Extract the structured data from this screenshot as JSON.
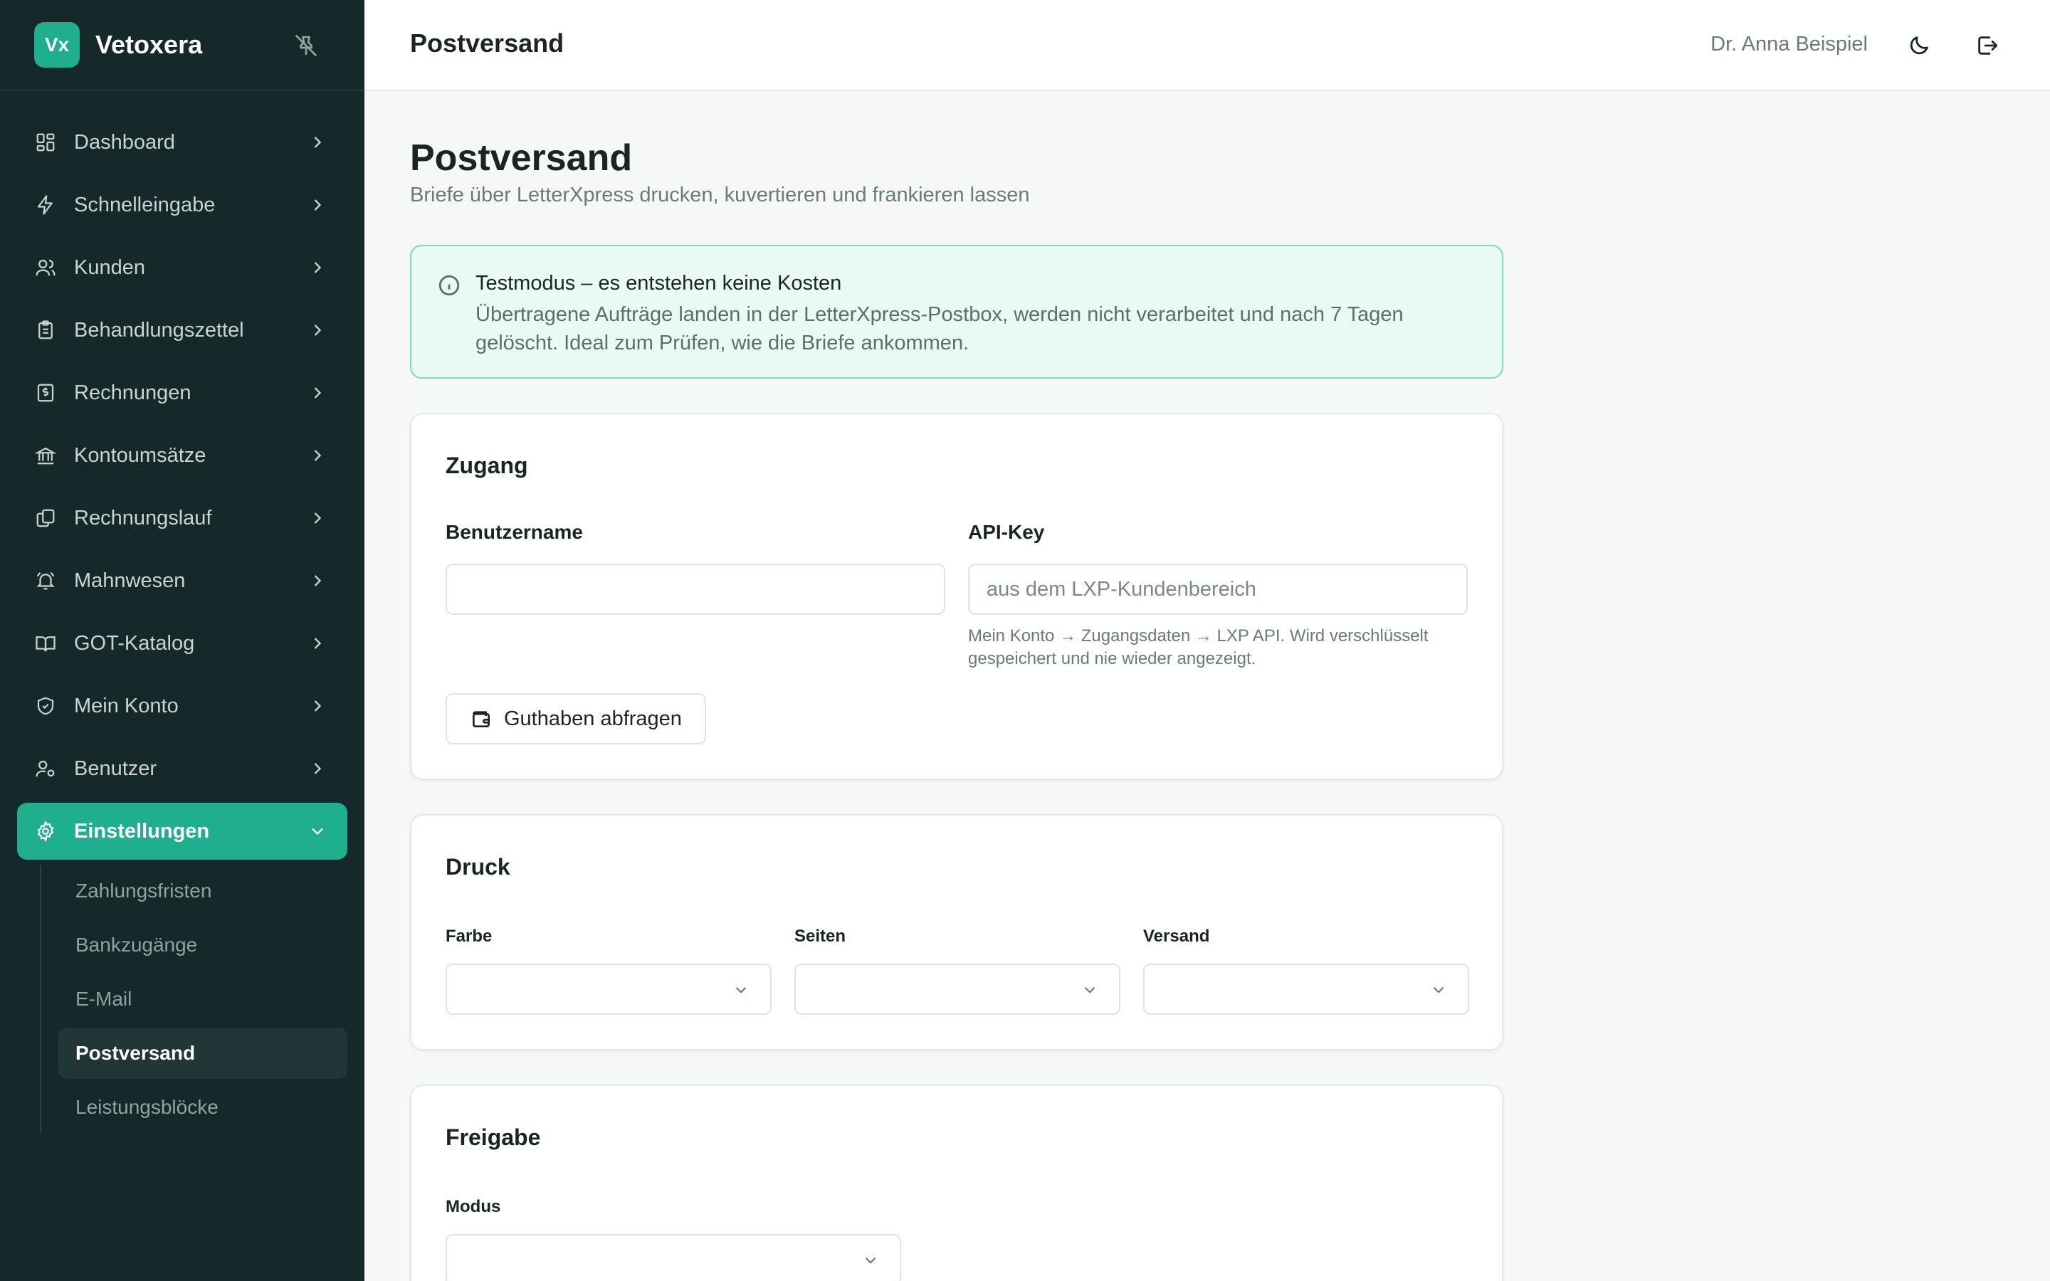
{
  "brand": {
    "logo_text": "Vx",
    "name": "Vetoxera"
  },
  "nav": {
    "items": [
      {
        "label": "Dashboard",
        "icon": "dashboard-icon"
      },
      {
        "label": "Schnelleingabe",
        "icon": "lightning-icon"
      },
      {
        "label": "Kunden",
        "icon": "users-icon"
      },
      {
        "label": "Behandlungszettel",
        "icon": "clipboard-icon"
      },
      {
        "label": "Rechnungen",
        "icon": "invoice-icon"
      },
      {
        "label": "Kontoumsätze",
        "icon": "bank-icon"
      },
      {
        "label": "Rechnungslauf",
        "icon": "copy-icon"
      },
      {
        "label": "Mahnwesen",
        "icon": "bell-icon"
      },
      {
        "label": "GOT-Katalog",
        "icon": "book-icon"
      },
      {
        "label": "Mein Konto",
        "icon": "shield-icon"
      },
      {
        "label": "Benutzer",
        "icon": "user-cog-icon"
      },
      {
        "label": "Einstellungen",
        "icon": "gear-icon",
        "active": true
      }
    ],
    "sub_items": [
      {
        "label": "Zahlungsfristen"
      },
      {
        "label": "Bankzugänge"
      },
      {
        "label": "E-Mail"
      },
      {
        "label": "Postversand",
        "active": true
      },
      {
        "label": "Leistungsblöcke"
      }
    ]
  },
  "topbar": {
    "title": "Postversand",
    "user": "Dr. Anna Beispiel"
  },
  "page": {
    "title": "Postversand",
    "subtitle": "Briefe über LetterXpress drucken, kuvertieren und frankieren lassen"
  },
  "alert": {
    "title": "Testmodus – es entstehen keine Kosten",
    "text": "Übertragene Aufträge landen in der LetterXpress-Postbox, werden nicht verarbeitet und nach 7 Tagen gelöscht. Ideal zum Prüfen, wie die Briefe ankommen."
  },
  "zugang": {
    "title": "Zugang",
    "username_label": "Benutzername",
    "username_value": "",
    "apikey_label": "API-Key",
    "apikey_placeholder": "aus dem LXP-Kundenbereich",
    "apikey_hint": "Mein Konto → Zugangsdaten → LXP API. Wird verschlüsselt gespeichert und nie wieder angezeigt.",
    "balance_button": "Guthaben abfragen"
  },
  "druck": {
    "title": "Druck",
    "farbe_label": "Farbe",
    "seiten_label": "Seiten",
    "versand_label": "Versand"
  },
  "freigabe": {
    "title": "Freigabe",
    "modus_label": "Modus"
  },
  "colors": {
    "sidebar_bg": "#15292a",
    "accent": "#1fae8e",
    "alert_bg": "#e9faf3",
    "alert_border": "#7fd9bb"
  }
}
